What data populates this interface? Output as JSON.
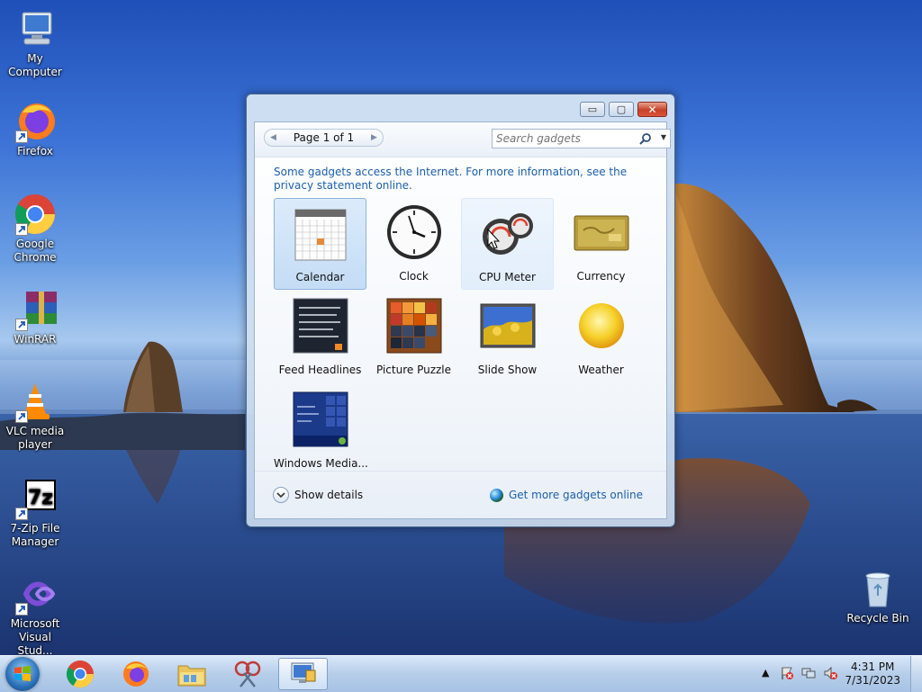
{
  "desktop": {
    "icons": [
      {
        "label": "My Computer",
        "icon": "computer-icon"
      },
      {
        "label": "Firefox",
        "icon": "firefox-icon"
      },
      {
        "label": "Google Chrome",
        "icon": "chrome-icon"
      },
      {
        "label": "WinRAR",
        "icon": "winrar-icon"
      },
      {
        "label": "VLC media player",
        "icon": "vlc-icon"
      },
      {
        "label": "7-Zip File Manager",
        "icon": "7zip-icon"
      },
      {
        "label": "Microsoft Visual Stud...",
        "icon": "visual-studio-icon"
      },
      {
        "label": "Recycle Bin",
        "icon": "recycle-bin-icon"
      }
    ]
  },
  "window": {
    "buttons": {
      "minimize": "▭",
      "maximize": "▢",
      "close": "✕"
    },
    "pager": {
      "label": "Page 1 of 1",
      "prev": "◀",
      "next": "▶"
    },
    "search": {
      "placeholder": "Search gadgets"
    },
    "notice": "Some gadgets access the Internet.  For more information, see the privacy statement online.",
    "gadgets": [
      {
        "name": "Calendar",
        "state": "selected",
        "icon": "calendar-icon"
      },
      {
        "name": "Clock",
        "state": "normal",
        "icon": "clock-icon"
      },
      {
        "name": "CPU Meter",
        "state": "hover",
        "icon": "cpu-meter-icon"
      },
      {
        "name": "Currency",
        "state": "normal",
        "icon": "currency-icon"
      },
      {
        "name": "Feed Headlines",
        "state": "normal",
        "icon": "feed-headlines-icon"
      },
      {
        "name": "Picture Puzzle",
        "state": "normal",
        "icon": "picture-puzzle-icon"
      },
      {
        "name": "Slide Show",
        "state": "normal",
        "icon": "slide-show-icon"
      },
      {
        "name": "Weather",
        "state": "normal",
        "icon": "weather-icon"
      },
      {
        "name": "Windows Media...",
        "state": "normal",
        "icon": "windows-media-center-icon"
      }
    ],
    "footer": {
      "show_details": "Show details",
      "get_more": "Get more gadgets online"
    }
  },
  "taskbar": {
    "pinned": [
      {
        "name": "chrome",
        "icon": "chrome-icon"
      },
      {
        "name": "firefox",
        "icon": "firefox-icon"
      },
      {
        "name": "explorer",
        "icon": "folder-icon"
      },
      {
        "name": "snipping-tool",
        "icon": "snipping-tool-icon"
      },
      {
        "name": "gadgets",
        "icon": "gadgets-window-icon",
        "active": true
      }
    ],
    "tray": {
      "time": "4:31 PM",
      "date": "7/31/2023",
      "show_hidden": "▲"
    }
  },
  "colors": {
    "link": "#1c5fa8",
    "selection": "#c4dcf5",
    "close_button": "#c64128"
  }
}
